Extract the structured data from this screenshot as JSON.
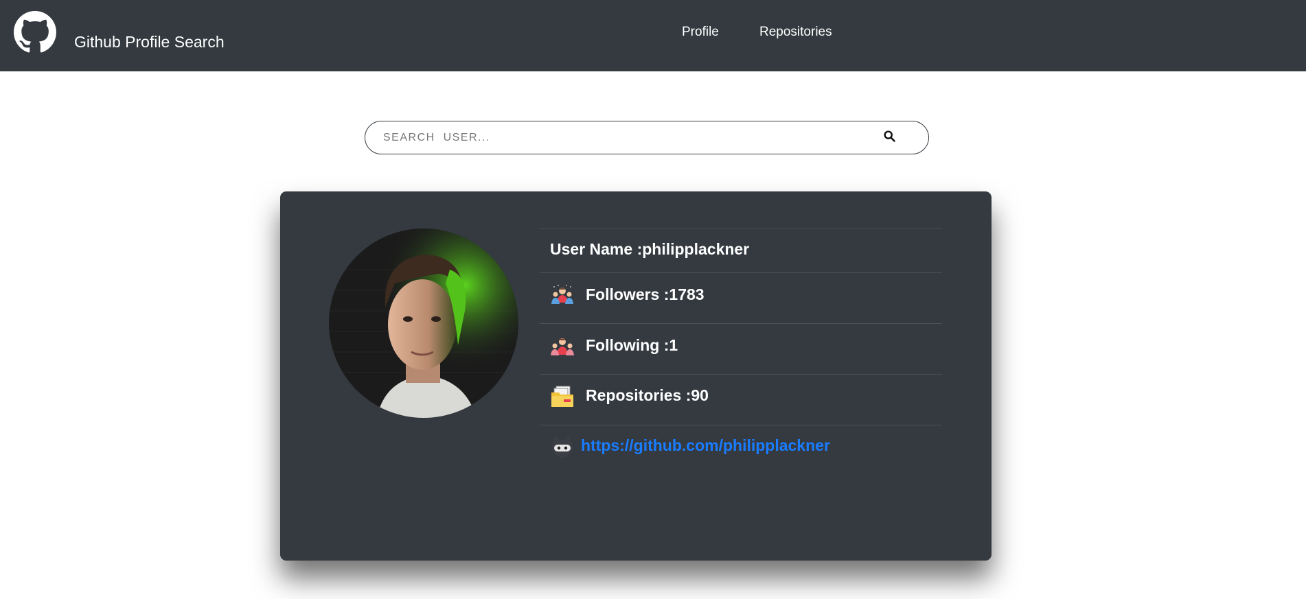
{
  "header": {
    "logo_icon": "github-octocat-icon",
    "title": "Github Profile Search",
    "nav": [
      {
        "label": "Profile"
      },
      {
        "label": "Repositories"
      }
    ]
  },
  "search": {
    "value": "",
    "placeholder": "SEARCH  USER...",
    "icon": "search-icon"
  },
  "profile": {
    "username_label": "User Name :",
    "username": "philipplackner",
    "followers_label": "Followers :",
    "followers": "1783",
    "following_label": "Following :",
    "following": "1",
    "repos_label": "Repositories :",
    "repos": "90",
    "url": "https://github.com/philipplackner",
    "icons": {
      "followers": "followers-group-icon",
      "following": "following-people-icon",
      "repos": "repository-folder-icon",
      "link": "github-ninja-icon"
    }
  },
  "colors": {
    "navbar": "#343a40",
    "card": "#343a40",
    "link": "#1a7cff",
    "text": "#ffffff"
  }
}
